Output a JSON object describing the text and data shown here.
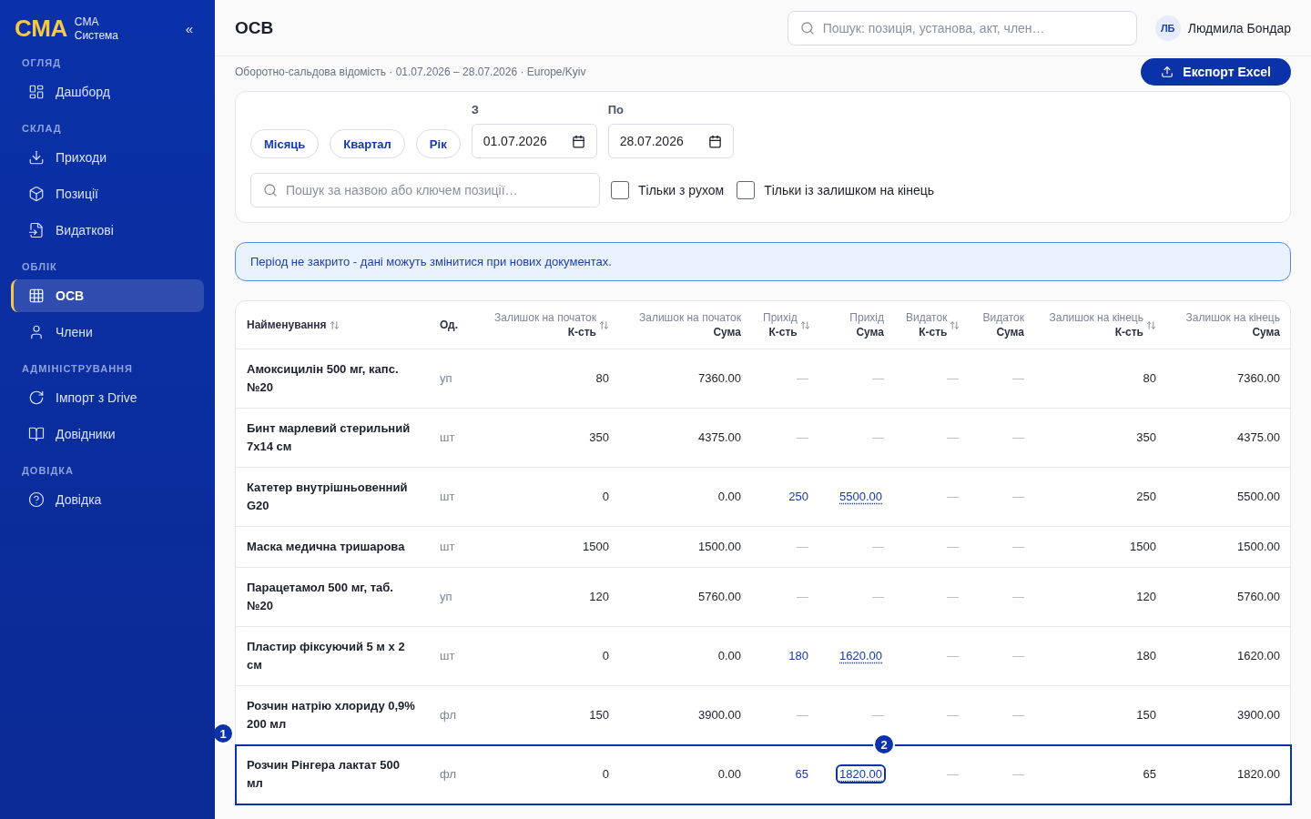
{
  "sidebar": {
    "logo": "CMA",
    "brand_lines": [
      "CMA",
      "Система"
    ],
    "collapse": "«",
    "sections": [
      {
        "label": "ОГЛЯД",
        "items": [
          {
            "label": "Дашборд",
            "selected": false
          }
        ]
      },
      {
        "label": "СКЛАД",
        "items": [
          {
            "label": "Приходи",
            "selected": false
          },
          {
            "label": "Позиції",
            "selected": false
          },
          {
            "label": "Видаткові",
            "selected": false
          }
        ]
      },
      {
        "label": "ОБЛІК",
        "items": [
          {
            "label": "ОСВ",
            "selected": true
          },
          {
            "label": "Члени",
            "selected": false
          }
        ]
      },
      {
        "label": "АДМІНІСТРУВАННЯ",
        "items": [
          {
            "label": "Імпорт з Drive",
            "selected": false
          },
          {
            "label": "Довідники",
            "selected": false
          }
        ]
      },
      {
        "label": "ДОВІДКА",
        "items": [
          {
            "label": "Довідка",
            "selected": false
          }
        ]
      }
    ]
  },
  "header": {
    "title": "ОСВ",
    "search_placeholder": "Пошук: позиція, установа, акт, член…",
    "user": {
      "initials": "ЛБ",
      "name": "Людмила Бондар"
    }
  },
  "subtitle": "Оборотно-сальдова відомість · 01.07.2026 – 28.07.2026 · Europe/Kyiv",
  "export_button": "Експорт Excel",
  "filters": {
    "presets": [
      "Місяць",
      "Квартал",
      "Рік"
    ],
    "dates": [
      {
        "label": "З",
        "value": "01.07.2026"
      },
      {
        "label": "По",
        "value": "28.07.2026"
      }
    ],
    "search_placeholder": "Пошук за назвою або ключем позиції…",
    "checkboxes": [
      {
        "label": "Тільки з рухом",
        "checked": false
      },
      {
        "label": "Тільки із залишком на кінець",
        "checked": false
      }
    ]
  },
  "notice": "Період не закрито - дані можуть змінитися при нових документах.",
  "table": {
    "columns": [
      {
        "lines": [
          "Найменування"
        ],
        "sortable": true
      },
      {
        "lines": [
          "Од."
        ],
        "sortable": false
      },
      {
        "lines": [
          "Залишок на початок",
          "К-сть"
        ],
        "sortable": true
      },
      {
        "lines": [
          "Залишок на початок",
          "Сума"
        ],
        "sortable": false
      },
      {
        "lines": [
          "Прихід",
          "К-сть"
        ],
        "sortable": true
      },
      {
        "lines": [
          "Прихід",
          "Сума"
        ],
        "sortable": false
      },
      {
        "lines": [
          "Видаток",
          "К-сть"
        ],
        "sortable": true
      },
      {
        "lines": [
          "Видаток",
          "Сума"
        ],
        "sortable": false
      },
      {
        "lines": [
          "Залишок на кінець",
          "К-сть"
        ],
        "sortable": true
      },
      {
        "lines": [
          "Залишок на кінець",
          "Сума"
        ],
        "sortable": false
      }
    ],
    "rows": [
      {
        "cells": [
          "Амоксицилін 500 мг, капс. №20",
          "уп",
          "80",
          "7360.00",
          "—",
          "—",
          "—",
          "—",
          "80",
          "7360.00"
        ],
        "linked": false,
        "selected": false
      },
      {
        "cells": [
          "Бинт марлевий стерильний 7x14 см",
          "шт",
          "350",
          "4375.00",
          "—",
          "—",
          "—",
          "—",
          "350",
          "4375.00"
        ],
        "linked": false,
        "selected": false
      },
      {
        "cells": [
          "Катетер внутрішньовенний G20",
          "шт",
          "0",
          "0.00",
          "250",
          "5500.00",
          "—",
          "—",
          "250",
          "5500.00"
        ],
        "linked": true,
        "selected": false
      },
      {
        "cells": [
          "Маска медична тришарова",
          "шт",
          "1500",
          "1500.00",
          "—",
          "—",
          "—",
          "—",
          "1500",
          "1500.00"
        ],
        "linked": false,
        "selected": false
      },
      {
        "cells": [
          "Парацетамол 500 мг, таб. №20",
          "уп",
          "120",
          "5760.00",
          "—",
          "—",
          "—",
          "—",
          "120",
          "5760.00"
        ],
        "linked": false,
        "selected": false
      },
      {
        "cells": [
          "Пластир фіксуючий 5 м х 2 см",
          "шт",
          "0",
          "0.00",
          "180",
          "1620.00",
          "—",
          "—",
          "180",
          "1620.00"
        ],
        "linked": true,
        "selected": false
      },
      {
        "cells": [
          "Розчин натрію хлориду 0,9% 200 мл",
          "фл",
          "150",
          "3900.00",
          "—",
          "—",
          "—",
          "—",
          "150",
          "3900.00"
        ],
        "linked": false,
        "selected": false
      },
      {
        "cells": [
          "Розчин Рінгера лактат 500 мл",
          "фл",
          "0",
          "0.00",
          "65",
          "1820.00",
          "—",
          "—",
          "65",
          "1820.00"
        ],
        "linked": true,
        "selected": true,
        "row_marker": "1",
        "sum_marker": "2"
      }
    ]
  }
}
